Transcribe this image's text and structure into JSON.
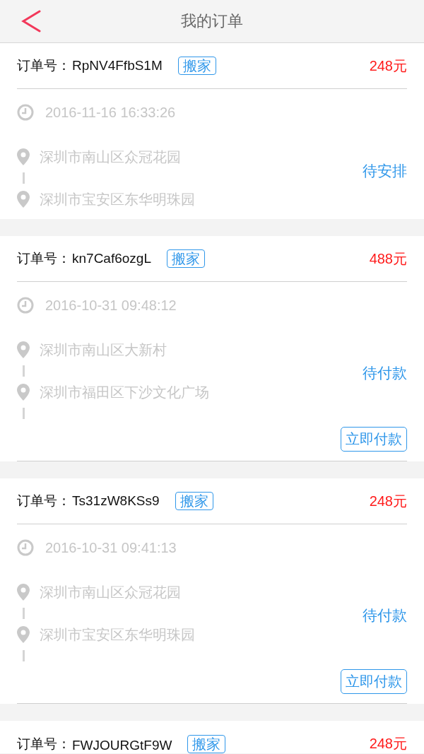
{
  "header": {
    "title": "我的订单"
  },
  "orders": [
    {
      "order_label": "订单号：",
      "order_no": "RpNV4FfbS1M",
      "tag": "搬家",
      "price": "248元",
      "time": "2016-11-16 16:33:26",
      "from": "深圳市南山区众冠花园",
      "to": "深圳市宝安区东华明珠园",
      "status": "待安排"
    },
    {
      "order_label": "订单号：",
      "order_no": "kn7Caf6ozgL",
      "tag": "搬家",
      "price": "488元",
      "time": "2016-10-31 09:48:12",
      "from": "深圳市南山区大新村",
      "to": "深圳市福田区下沙文化广场",
      "status": "待付款",
      "action": "立即付款"
    },
    {
      "order_label": "订单号：",
      "order_no": "Ts31zW8KSs9",
      "tag": "搬家",
      "price": "248元",
      "time": "2016-10-31 09:41:13",
      "from": "深圳市南山区众冠花园",
      "to": "深圳市宝安区东华明珠园",
      "status": "待付款",
      "action": "立即付款"
    },
    {
      "order_label": "订单号：",
      "order_no": "FWJOURGtF9W",
      "tag": "搬家",
      "price": "248元"
    }
  ]
}
